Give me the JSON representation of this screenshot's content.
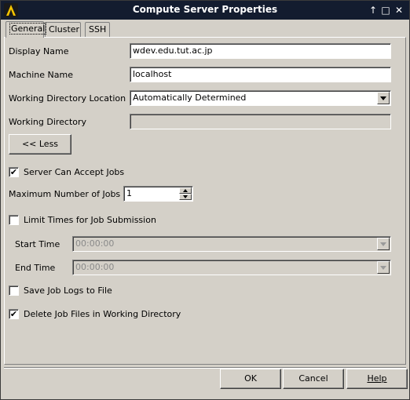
{
  "window": {
    "title": "Compute Server Properties",
    "controls": [
      "↑",
      "□",
      "✕"
    ]
  },
  "tabs": [
    {
      "label": "General",
      "active": true
    },
    {
      "label": "Cluster",
      "active": false
    },
    {
      "label": "SSH",
      "active": false
    }
  ],
  "general": {
    "display_name_label": "Display Name",
    "display_name_value": "wdev.edu.tut.ac.jp",
    "machine_name_label": "Machine Name",
    "machine_name_value": "localhost",
    "working_dir_location_label": "Working Directory Location",
    "working_dir_location_value": "Automatically Determined",
    "working_dir_label": "Working Directory",
    "working_dir_value": "",
    "less_button": "<< Less",
    "server_accept_jobs_label": "Server Can Accept Jobs",
    "server_accept_jobs_checked": true,
    "max_jobs_label": "Maximum Number of Jobs",
    "max_jobs_value": "1",
    "limit_times_label": "Limit Times for Job Submission",
    "limit_times_checked": false,
    "start_time_label": "Start Time",
    "start_time_value": "00:00:00",
    "end_time_label": "End Time",
    "end_time_value": "00:00:00",
    "save_logs_label": "Save Job Logs to File",
    "save_logs_checked": false,
    "delete_files_label": "Delete Job Files in Working Directory",
    "delete_files_checked": true
  },
  "footer": {
    "ok": "OK",
    "cancel": "Cancel",
    "help": "Help"
  },
  "check_glyph": "✔"
}
